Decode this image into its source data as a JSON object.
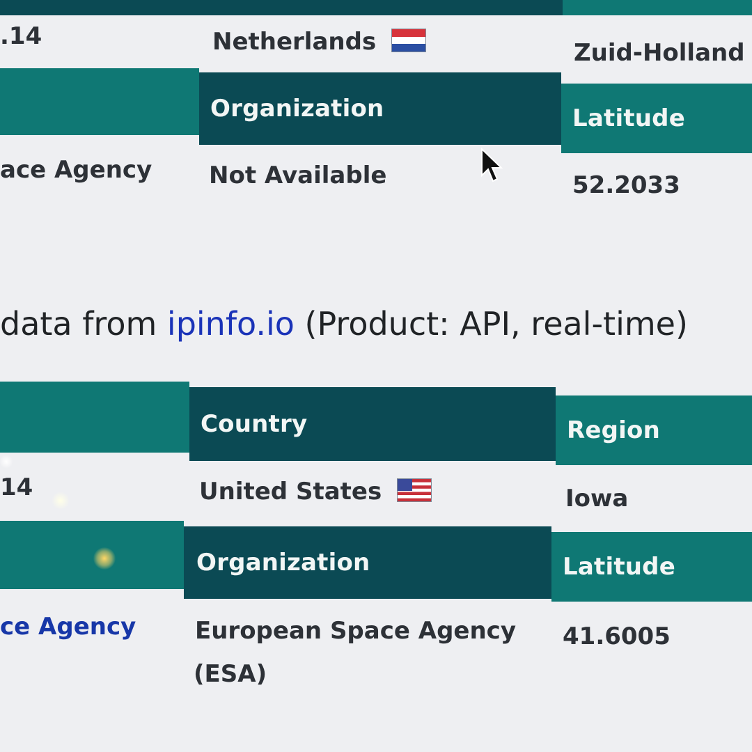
{
  "table1": {
    "row1": {
      "ip_fragment": ".14",
      "country": "Netherlands",
      "region": "Zuid-Holland"
    },
    "headers": {
      "organization": "Organization",
      "latitude": "Latitude"
    },
    "row2": {
      "isp_fragment": "ace Agency",
      "organization": "Not Available",
      "latitude": "52.2033"
    }
  },
  "note": {
    "prefix": "data from",
    "link": "ipinfo.io",
    "suffix": "(Product: API, real-time)"
  },
  "table2": {
    "headers_top": {
      "country": "Country",
      "region": "Region"
    },
    "row1": {
      "ip_fragment": "14",
      "country": "United States",
      "region": "Iowa"
    },
    "headers": {
      "organization": "Organization",
      "latitude": "Latitude"
    },
    "row2": {
      "isp_fragment": "ce Agency",
      "organization_line1": "European Space Agency",
      "organization_line2": "(ESA)",
      "latitude": "41.6005"
    }
  },
  "colors": {
    "header_teal": "#0f7874",
    "header_dark": "#0b4a54",
    "link": "#1a33b8",
    "text": "#2d3137",
    "background": "#eeeff2"
  },
  "icons": [
    "netherlands-flag-icon",
    "united-states-flag-icon",
    "mouse-cursor-icon"
  ]
}
